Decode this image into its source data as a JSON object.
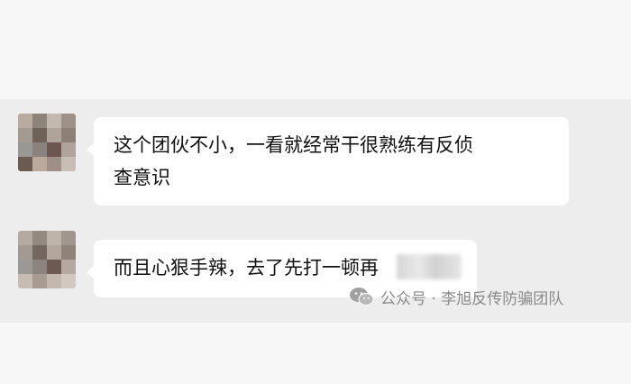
{
  "messages": [
    {
      "lines": [
        "这个团伙不小，一看就经常干很熟练有反侦",
        "查意识"
      ]
    },
    {
      "lines": [
        "而且心狠手辣，去了先打一顿再"
      ]
    }
  ],
  "avatar_colors": [
    [
      "#b8aba0",
      "#8e8378",
      "#c4b9ae",
      "#9e9187"
    ],
    [
      "#a39a92",
      "#6f6259",
      "#b0a49a",
      "#8b7f76"
    ],
    [
      "#9a9894",
      "#8a837d",
      "#6c5650",
      "#b1a39b"
    ],
    [
      "#6b5c52",
      "#bba99b",
      "#9d8f85",
      "#c8bdb5"
    ]
  ],
  "avatar2_colors": [
    [
      "#b4aaa2",
      "#93897f",
      "#bfb4aa",
      "#a1968d"
    ],
    [
      "#a29a93",
      "#73675f",
      "#b2a69d",
      "#8e8279"
    ],
    [
      "#9c9995",
      "#8c857f",
      "#6f5a53",
      "#b5a8a0"
    ],
    [
      "#c7bcb3",
      "#a89b92",
      "#c2b6ad",
      "#d1c8c1"
    ]
  ],
  "watermark": {
    "text": "公众号 · 李旭反传防骗团队",
    "icon": "wechat-icon"
  },
  "colors": {
    "chat_bg": "#ededed",
    "page_bg": "#f7f7f7",
    "bubble": "#ffffff"
  }
}
